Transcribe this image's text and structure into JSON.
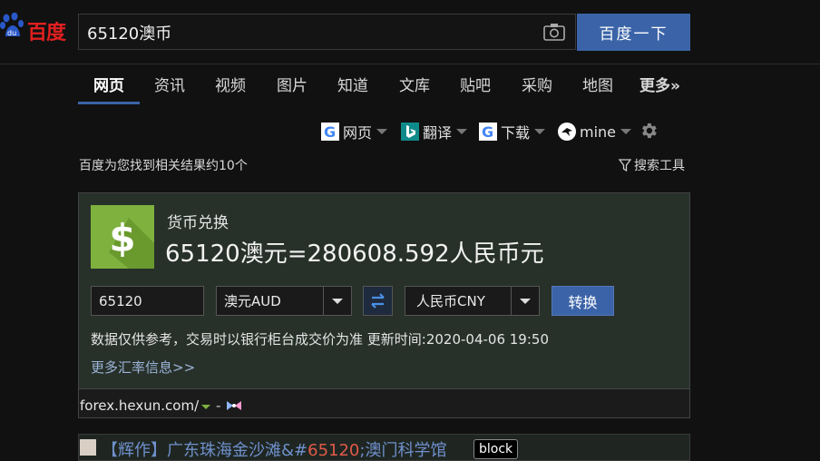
{
  "header": {
    "logo_text": "百度",
    "search_value": "65120澳币",
    "search_button": "百度一下"
  },
  "tabs": [
    {
      "label": "网页",
      "active": true
    },
    {
      "label": "资讯"
    },
    {
      "label": "视频"
    },
    {
      "label": "图片"
    },
    {
      "label": "知道"
    },
    {
      "label": "文库"
    },
    {
      "label": "贴吧"
    },
    {
      "label": "采购"
    },
    {
      "label": "地图"
    },
    {
      "label": "更多»"
    }
  ],
  "tools": {
    "google_web": "网页",
    "bing_translate": "翻译",
    "google_download": "下载",
    "mine": "mine"
  },
  "result_count": "百度为您找到相关结果约10个",
  "search_tools": "搜索工具",
  "currency": {
    "title": "货币兑换",
    "result": "65120澳元=280608.592人民币元",
    "amount": "65120",
    "from_currency": "澳元AUD",
    "to_currency": "人民币CNY",
    "convert_button": "转换",
    "disclaimer": "数据仅供参考，交易时以银行柜台成交价为准 更新时间:2020-04-06 19:50",
    "more_rates": "更多汇率信息>>",
    "source_url": "forex.hexun.com/",
    "source_dash": "-"
  },
  "result2": {
    "title_before": "【辉作】广东珠海金沙滩&#",
    "title_highlight": "65120",
    "title_after": ";澳门科学馆",
    "badge": "block"
  },
  "colors": {
    "accent": "#3b64a8",
    "logo_red": "#e02020",
    "dollar_green": "#7fb13e",
    "card_bg": "#27312a",
    "link": "#9db4d8"
  }
}
